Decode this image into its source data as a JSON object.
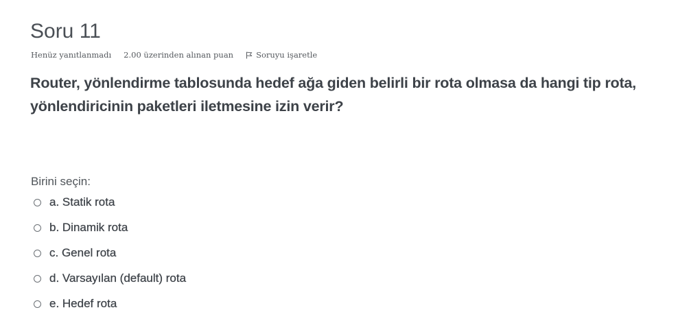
{
  "question": {
    "title": "Soru 11",
    "state": "Henüz yanıtlanmadı",
    "grade": "2.00 üzerinden alınan puan",
    "flag_label": "Soruyu işaretle",
    "flag_icon": "flag-outline-icon",
    "text": " Router, yönlendirme tablosunda hedef ağa giden belirli bir rota olmasa da hangi tip rota, yönlendiricinin paketleri iletmesine izin verir?"
  },
  "answer_prompt": "Birini seçin:",
  "answers": [
    {
      "label": "a. Statik rota",
      "selected": false
    },
    {
      "label": "b. Dinamik rota",
      "selected": false
    },
    {
      "label": "c. Genel rota",
      "selected": false
    },
    {
      "label": "d. Varsayılan (default) rota",
      "selected": false
    },
    {
      "label": "e. Hedef rota",
      "selected": false
    }
  ],
  "colors": {
    "text": "#3d4248",
    "muted": "#55595e",
    "background": "#ffffff"
  }
}
